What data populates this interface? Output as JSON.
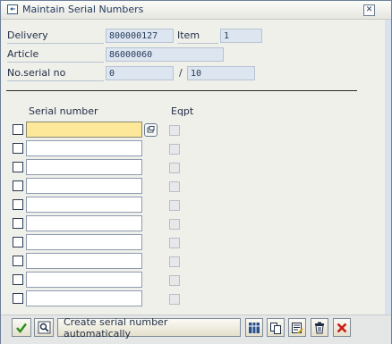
{
  "window": {
    "title": "Maintain Serial Numbers",
    "close_glyph": "✕"
  },
  "header": {
    "delivery": {
      "label": "Delivery",
      "value": "800000127"
    },
    "item": {
      "label": "Item",
      "value": "1"
    },
    "article": {
      "label": "Article",
      "value": "86000060"
    },
    "noserial": {
      "label": "No.serial no",
      "value": "0",
      "separator": "/",
      "total": "10"
    }
  },
  "table": {
    "col_serial": "Serial number",
    "col_eqpt": "Eqpt",
    "rows": [
      {
        "serial": ""
      },
      {
        "serial": ""
      },
      {
        "serial": ""
      },
      {
        "serial": ""
      },
      {
        "serial": ""
      },
      {
        "serial": ""
      },
      {
        "serial": ""
      },
      {
        "serial": ""
      },
      {
        "serial": ""
      },
      {
        "serial": ""
      }
    ]
  },
  "toolbar": {
    "create_label": "Create serial number automatically",
    "icons": [
      "check-icon",
      "search-icon",
      "grid-icon",
      "copy-icon",
      "edit-list-icon",
      "delete-icon",
      "cancel-icon"
    ]
  },
  "colors": {
    "active_field": "#fde89a",
    "readonly_field": "#dde6f0",
    "dialog_bg": "#f0f0eb",
    "cancel_red": "#c8201a",
    "check_green": "#2a8a1a"
  }
}
